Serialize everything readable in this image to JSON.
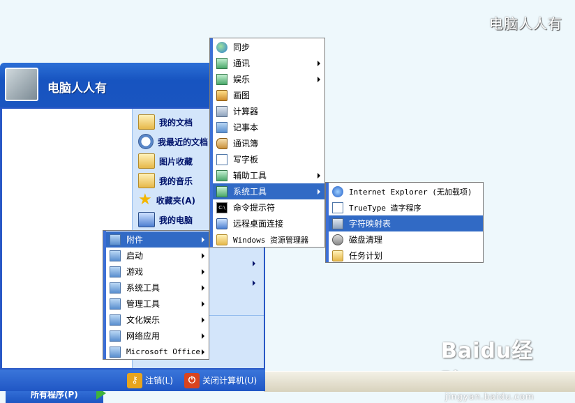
{
  "watermark": {
    "top_right": "电脑人人有",
    "baidu_main": "Baidu经验",
    "baidu_sub": "jingyan.baidu.com"
  },
  "start_menu": {
    "username": "电脑人人有",
    "right_items": [
      {
        "label": "我的文档",
        "icon": "folder-icon"
      },
      {
        "label": "我最近的文档",
        "icon": "recent-icon"
      },
      {
        "label": "图片收藏",
        "icon": "folder-icon"
      },
      {
        "label": "我的音乐",
        "icon": "folder-icon"
      },
      {
        "label": "收藏夹(A)",
        "icon": "star-icon"
      },
      {
        "label": "我的电脑",
        "icon": "computer-icon"
      }
    ],
    "all_programs": "所有程序(P)",
    "logoff": "注销(L)",
    "shutdown": "关闭计算机(U)"
  },
  "programs_menu": [
    {
      "label": "附件",
      "submenu": true,
      "selected": true
    },
    {
      "label": "启动",
      "submenu": true
    },
    {
      "label": "游戏",
      "submenu": true
    },
    {
      "label": "系统工具",
      "submenu": true
    },
    {
      "label": "管理工具",
      "submenu": true
    },
    {
      "label": "文化娱乐",
      "submenu": true
    },
    {
      "label": "网络应用",
      "submenu": true
    },
    {
      "label": "Microsoft Office",
      "submenu": true
    }
  ],
  "accessories_menu": [
    {
      "label": "同步",
      "icon": "sync-icon"
    },
    {
      "label": "通讯",
      "submenu": true,
      "icon": "program-group-icon"
    },
    {
      "label": "娱乐",
      "submenu": true,
      "icon": "program-group-icon"
    },
    {
      "label": "画图",
      "icon": "paint-icon"
    },
    {
      "label": "计算器",
      "icon": "calculator-icon"
    },
    {
      "label": "记事本",
      "icon": "notepad-icon"
    },
    {
      "label": "通讯簿",
      "icon": "address-book-icon"
    },
    {
      "label": "写字板",
      "icon": "wordpad-icon"
    },
    {
      "label": "辅助工具",
      "submenu": true,
      "icon": "program-group-icon"
    },
    {
      "label": "系统工具",
      "submenu": true,
      "selected": true,
      "icon": "program-group-icon"
    },
    {
      "label": "命令提示符",
      "icon": "cmd-icon"
    },
    {
      "label": "远程桌面连接",
      "icon": "remote-desktop-icon"
    },
    {
      "label": "Windows 资源管理器",
      "icon": "explorer-icon"
    }
  ],
  "system_tools_menu": [
    {
      "label": "Internet Explorer (无加载项)",
      "icon": "ie-icon"
    },
    {
      "label": "TrueType 造字程序",
      "icon": "truetype-icon"
    },
    {
      "label": "字符映射表",
      "selected": true,
      "icon": "charmap-icon"
    },
    {
      "label": "磁盘清理",
      "icon": "disk-cleanup-icon"
    },
    {
      "label": "任务计划",
      "icon": "scheduled-tasks-icon"
    }
  ],
  "colors": {
    "xp_blue": "#2958c6",
    "highlight": "#316ac5",
    "right_pane": "#d3e5fa"
  }
}
